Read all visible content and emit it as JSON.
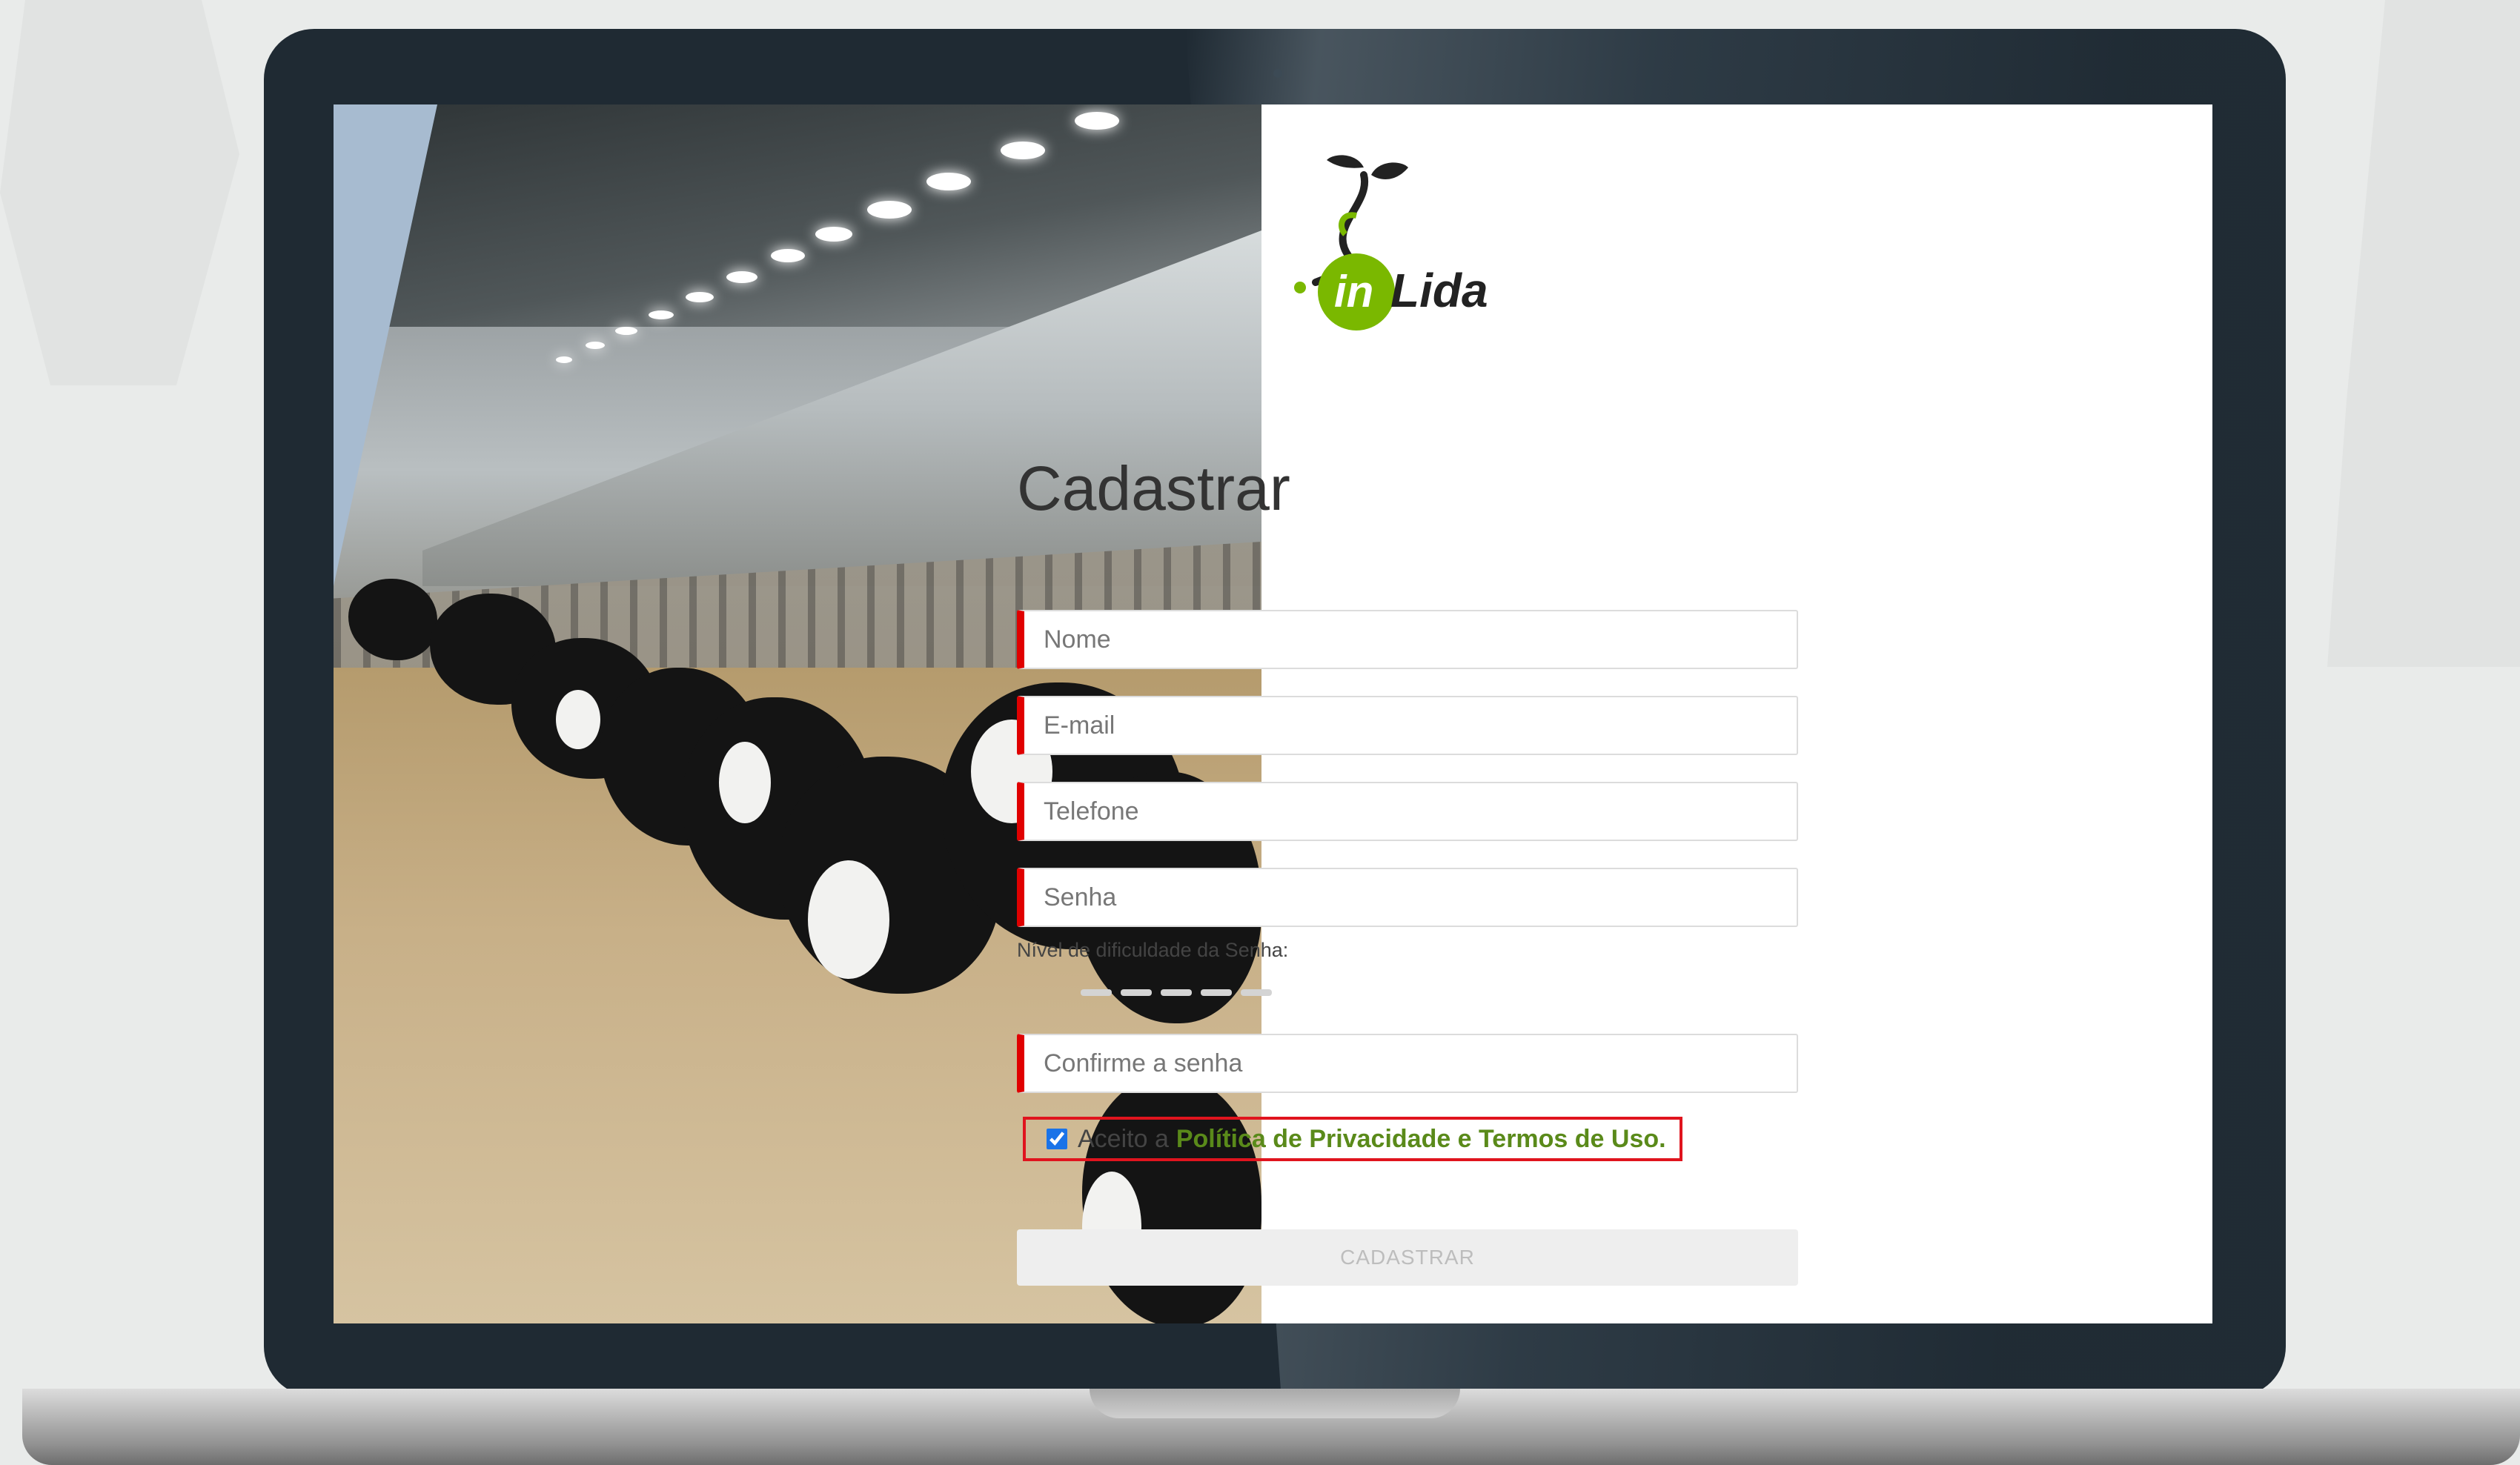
{
  "brand": {
    "logo_text_in": "in",
    "logo_text_lida": "Lida",
    "logo_green": "#7ab800",
    "logo_dark": "#222222"
  },
  "form": {
    "title": "Cadastrar",
    "fields": {
      "nome": {
        "placeholder": "Nome"
      },
      "email": {
        "placeholder": "E-mail"
      },
      "telefone": {
        "placeholder": "Telefone"
      },
      "senha": {
        "placeholder": "Senha"
      },
      "confirmar": {
        "placeholder": "Confirme a senha"
      }
    },
    "strength_label": "Nível de dificuldade da Senha:",
    "terms": {
      "prefix": "Aceito a",
      "link": "Política de Privacidade e Termos de Uso.",
      "checked": true
    },
    "submit_label": "CADASTRAR"
  },
  "colors": {
    "required_border": "#e00000",
    "link_green": "#5a8a1a",
    "highlight_box": "#e0141e"
  }
}
